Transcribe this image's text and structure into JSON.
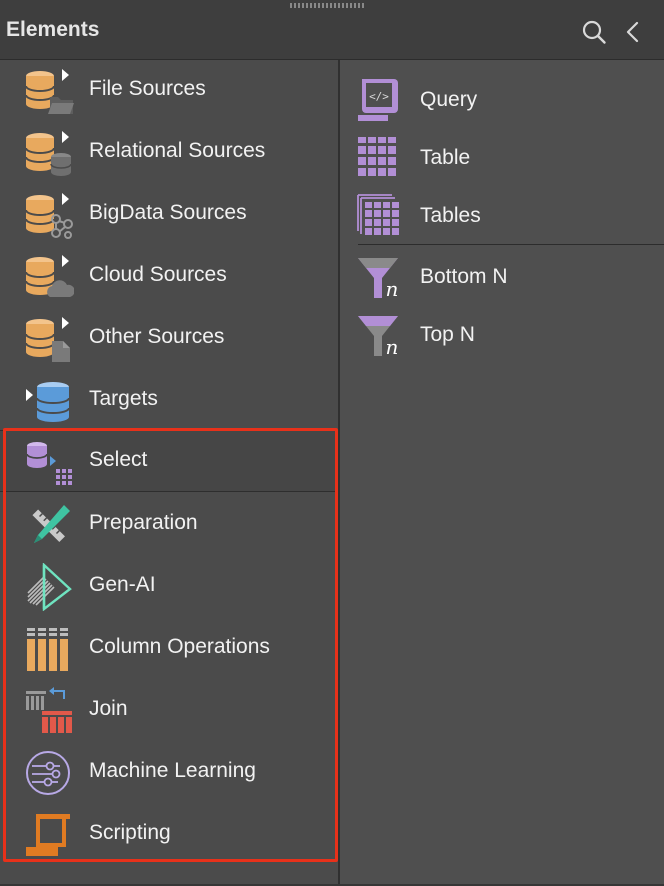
{
  "panel": {
    "title": "Elements"
  },
  "icons": {
    "search": "search-icon",
    "collapse": "chevron-left-icon"
  },
  "categories": [
    {
      "label": "File Sources",
      "icon": "file-sources-icon"
    },
    {
      "label": "Relational Sources",
      "icon": "relational-sources-icon"
    },
    {
      "label": "BigData Sources",
      "icon": "bigdata-sources-icon"
    },
    {
      "label": "Cloud Sources",
      "icon": "cloud-sources-icon"
    },
    {
      "label": "Other Sources",
      "icon": "other-sources-icon"
    },
    {
      "label": "Targets",
      "icon": "targets-icon"
    },
    {
      "label": "Select",
      "icon": "select-icon",
      "selected": true
    },
    {
      "label": "Preparation",
      "icon": "preparation-icon"
    },
    {
      "label": "Gen-AI",
      "icon": "gen-ai-icon"
    },
    {
      "label": "Column Operations",
      "icon": "column-operations-icon"
    },
    {
      "label": "Join",
      "icon": "join-icon"
    },
    {
      "label": "Machine Learning",
      "icon": "machine-learning-icon"
    },
    {
      "label": "Scripting",
      "icon": "scripting-icon"
    }
  ],
  "elements": [
    {
      "label": "Query",
      "icon": "query-icon"
    },
    {
      "label": "Table",
      "icon": "table-icon"
    },
    {
      "label": "Tables",
      "icon": "tables-icon"
    },
    {
      "label": "Bottom N",
      "icon": "bottom-n-icon"
    },
    {
      "label": "Top N",
      "icon": "top-n-icon"
    }
  ],
  "colors": {
    "source_db": "#e8a95e",
    "target_db": "#5b9bd9",
    "select_purple": "#b28fd6",
    "highlight_border": "#e8311a",
    "preparation_green": "#3fc4a2",
    "scripting_orange": "#e07b22"
  }
}
